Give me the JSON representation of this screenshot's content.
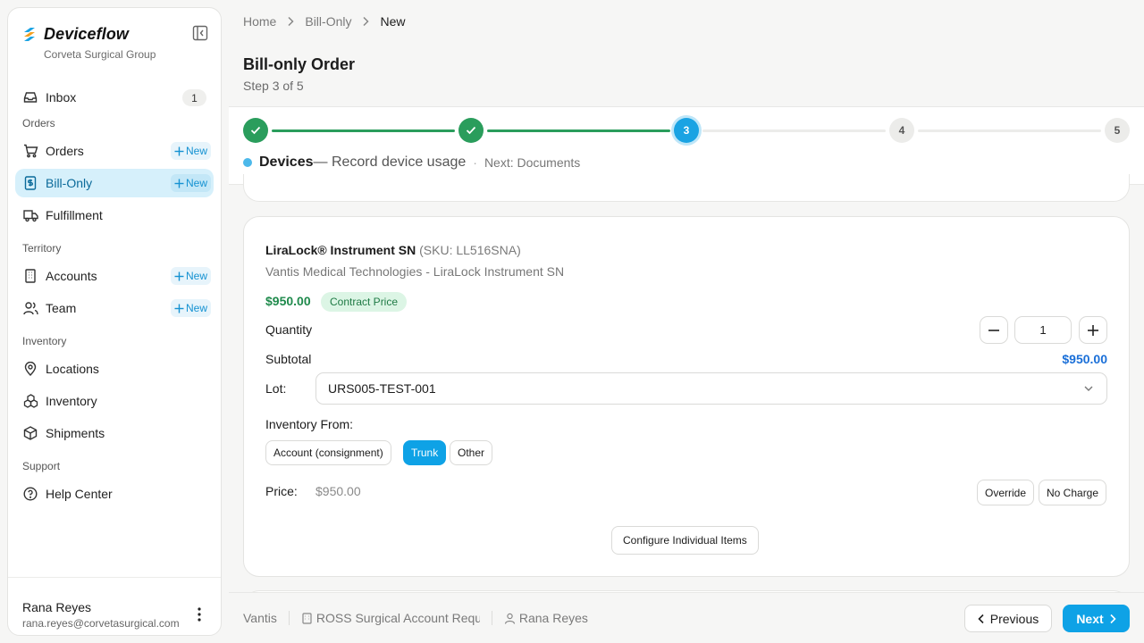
{
  "app": {
    "name": "Deviceflow",
    "org": "Corveta Surgical Group"
  },
  "sidebar": {
    "inbox": {
      "label": "Inbox",
      "count": "1"
    },
    "sections": {
      "orders": "Orders",
      "territory": "Territory",
      "inventory": "Inventory",
      "support": "Support"
    },
    "new_label": "New",
    "items": {
      "orders": "Orders",
      "bill_only": "Bill-Only",
      "fulfillment": "Fulfillment",
      "accounts": "Accounts",
      "team": "Team",
      "locations": "Locations",
      "inventory": "Inventory",
      "shipments": "Shipments",
      "help": "Help Center"
    },
    "active": "bill_only",
    "user": {
      "name": "Rana Reyes",
      "email": "rana.reyes@corvetasurgical.com"
    }
  },
  "breadcrumb": {
    "home": "Home",
    "section": "Bill-Only",
    "current": "New"
  },
  "page": {
    "title": "Bill-only Order",
    "subtitle": "Step 3 of 5"
  },
  "stepper": {
    "steps": [
      {
        "label": "1",
        "state": "done"
      },
      {
        "label": "2",
        "state": "done"
      },
      {
        "label": "3",
        "state": "current"
      },
      {
        "label": "4",
        "state": "todo"
      },
      {
        "label": "5",
        "state": "todo"
      }
    ],
    "current_name": "Devices",
    "current_desc": "— Record device usage",
    "separator": "·",
    "next": "Next: Documents"
  },
  "device": {
    "name": "LiraLock® Instrument SN",
    "sku": "(SKU: LL516SNA)",
    "manufacturer": "Vantis Medical Technologies - LiraLock Instrument SN",
    "price": "$950.00",
    "price_tag": "Contract Price",
    "quantity_label": "Quantity",
    "quantity": "1",
    "subtotal_label": "Subtotal",
    "subtotal": "$950.00",
    "lot_label": "Lot:",
    "lot_value": "URS005-TEST-001",
    "inventory_from_label": "Inventory From:",
    "inventory_options": [
      "Account (consignment)",
      "Trunk",
      "Other"
    ],
    "inventory_selected": "Trunk",
    "price_label": "Price:",
    "price_value": "$950.00",
    "override_label": "Override",
    "no_charge_label": "No Charge",
    "configure_label": "Configure Individual Items"
  },
  "footer": {
    "manufacturer": "Vantis",
    "account": "ROSS Surgical Account Requ",
    "rep": "Rana Reyes",
    "previous_label": "Previous",
    "next_label": "Next"
  },
  "colors": {
    "accent": "#0ea2e6",
    "success": "#2a9d5c",
    "active_bg": "#d6f0fb"
  }
}
